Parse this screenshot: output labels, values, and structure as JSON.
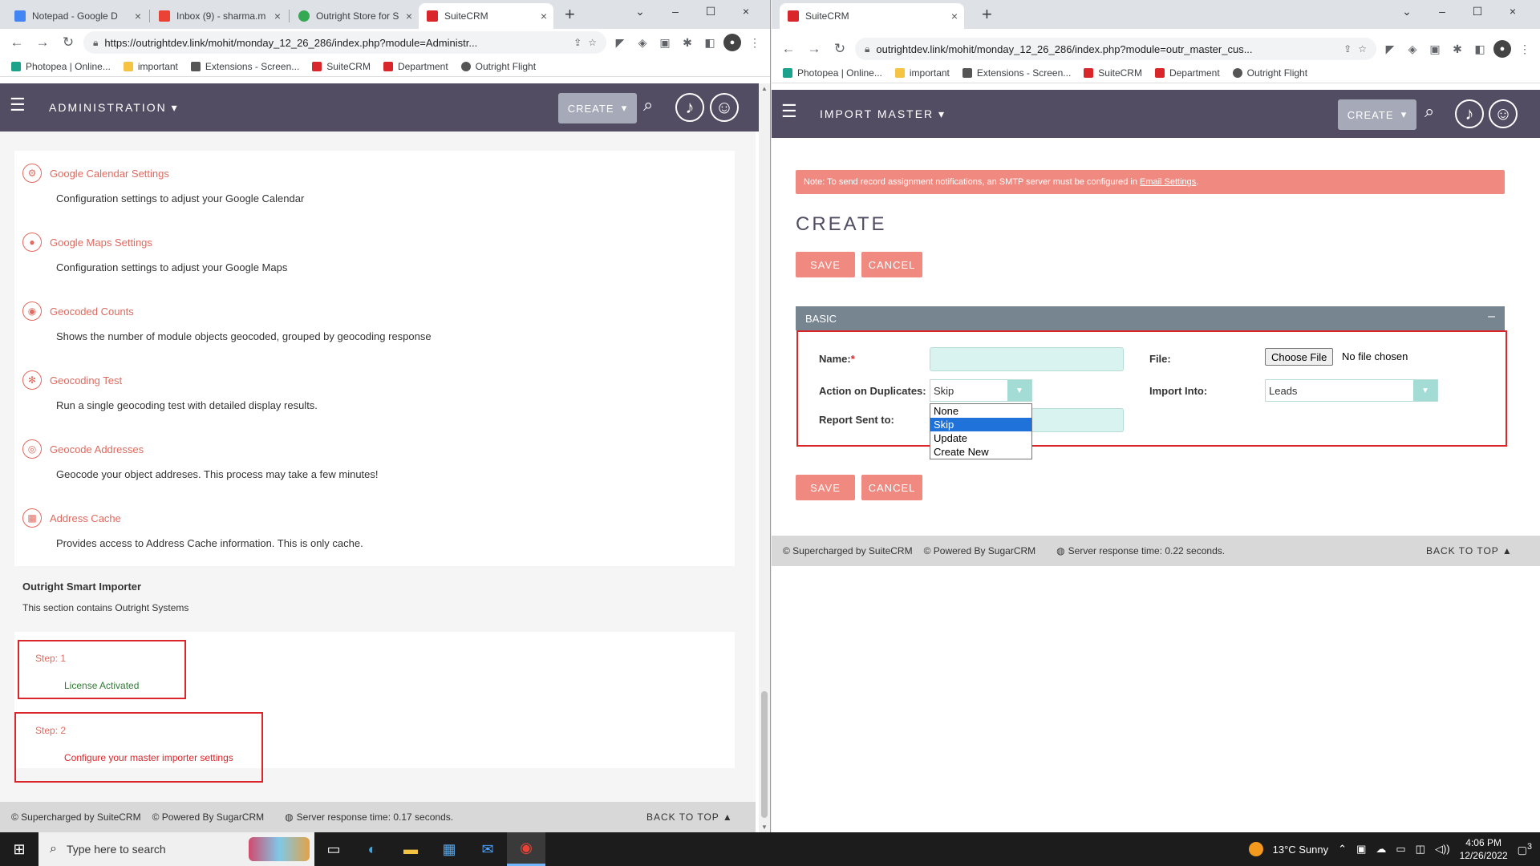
{
  "left": {
    "tabs": [
      {
        "label": "Notepad - Google D",
        "color": "#4285f4"
      },
      {
        "label": "Inbox (9) - sharma.m",
        "color": "#ea4335"
      },
      {
        "label": "Outright Store for S",
        "color": "#34a853"
      },
      {
        "label": "SuiteCRM",
        "color": "#d9262b"
      }
    ],
    "url": "https://outrightdev.link/mohit/monday_12_26_286/index.php?module=Administr...",
    "module_title": "ADMINISTRATION",
    "create_label": "CREATE",
    "items": [
      {
        "title": "Google Calendar Settings",
        "desc": "Configuration settings to adjust your Google Calendar",
        "icon": "calendar-gear-icon",
        "glyph": "⚙"
      },
      {
        "title": "Google Maps Settings",
        "desc": "Configuration settings to adjust your Google Maps",
        "icon": "map-marker-icon",
        "glyph": "●"
      },
      {
        "title": "Geocoded Counts",
        "desc": "Shows the number of module objects geocoded, grouped by geocoding response",
        "icon": "map-pin-icon",
        "glyph": "◉"
      },
      {
        "title": "Geocoding Test",
        "desc": "Run a single geocoding test with detailed display results.",
        "icon": "geocoding-test-icon",
        "glyph": "✻"
      },
      {
        "title": "Geocode Addresses",
        "desc": "Geocode your object addreses. This process may take a few minutes!",
        "icon": "target-icon",
        "glyph": "◎"
      },
      {
        "title": "Address Cache",
        "desc": "Provides access to Address Cache information. This is only cache.",
        "icon": "cache-icon",
        "glyph": "▦"
      }
    ],
    "section_title": "Outright Smart Importer",
    "section_desc": "This section contains Outright Systems",
    "steps": [
      {
        "label": "Step: 1",
        "text": "License Activated",
        "color": "#2e7d32"
      },
      {
        "label": "Step: 2",
        "text": "Configure your master importer settings",
        "color": "#d9262b"
      }
    ],
    "footer": {
      "supercharged": "© Supercharged by SuiteCRM",
      "powered": "© Powered By SugarCRM",
      "response": "Server response time: 0.17 seconds.",
      "back_to_top": "BACK TO TOP ▲"
    }
  },
  "right": {
    "tab_label": "SuiteCRM",
    "url": "outrightdev.link/mohit/monday_12_26_286/index.php?module=outr_master_cus...",
    "module_title": "IMPORT MASTER",
    "create_label": "CREATE",
    "notice_text": "Note: To send record assignment notifications, an SMTP server must be configured in",
    "notice_link": "Email Settings",
    "notice_end": ".",
    "page_heading": "CREATE",
    "save_label": "SAVE",
    "cancel_label": "CANCEL",
    "panel_title": "BASIC",
    "collapse_glyph": "–",
    "form": {
      "name_label": "Name:",
      "required_mark": "*",
      "file_label": "File:",
      "choose_file": "Choose File",
      "no_file": "No file chosen",
      "duplicates_label": "Action on Duplicates:",
      "duplicates_value": "Skip",
      "duplicates_options": [
        "None",
        "Skip",
        "Update",
        "Create New"
      ],
      "import_into_label": "Import Into:",
      "import_into_value": "Leads",
      "report_label": "Report Sent to:"
    },
    "footer": {
      "supercharged": "© Supercharged by SuiteCRM",
      "powered": "© Powered By SugarCRM",
      "response": "Server response time: 0.22 seconds.",
      "back_to_top": "BACK TO TOP ▲"
    }
  },
  "bookmarks": [
    {
      "label": "Photopea | Online...",
      "color": "#1aa28c"
    },
    {
      "label": "important",
      "color": "#f6c342"
    },
    {
      "label": "Extensions - Screen...",
      "color": "#555555"
    },
    {
      "label": "SuiteCRM",
      "color": "#d9262b"
    },
    {
      "label": "Department",
      "color": "#d9262b"
    },
    {
      "label": "Outright Flight",
      "color": "#555555"
    }
  ],
  "taskbar": {
    "search_placeholder": "Type here to search",
    "weather": "13°C  Sunny",
    "time": "4:06 PM",
    "date": "12/26/2022",
    "notifications": "3"
  }
}
